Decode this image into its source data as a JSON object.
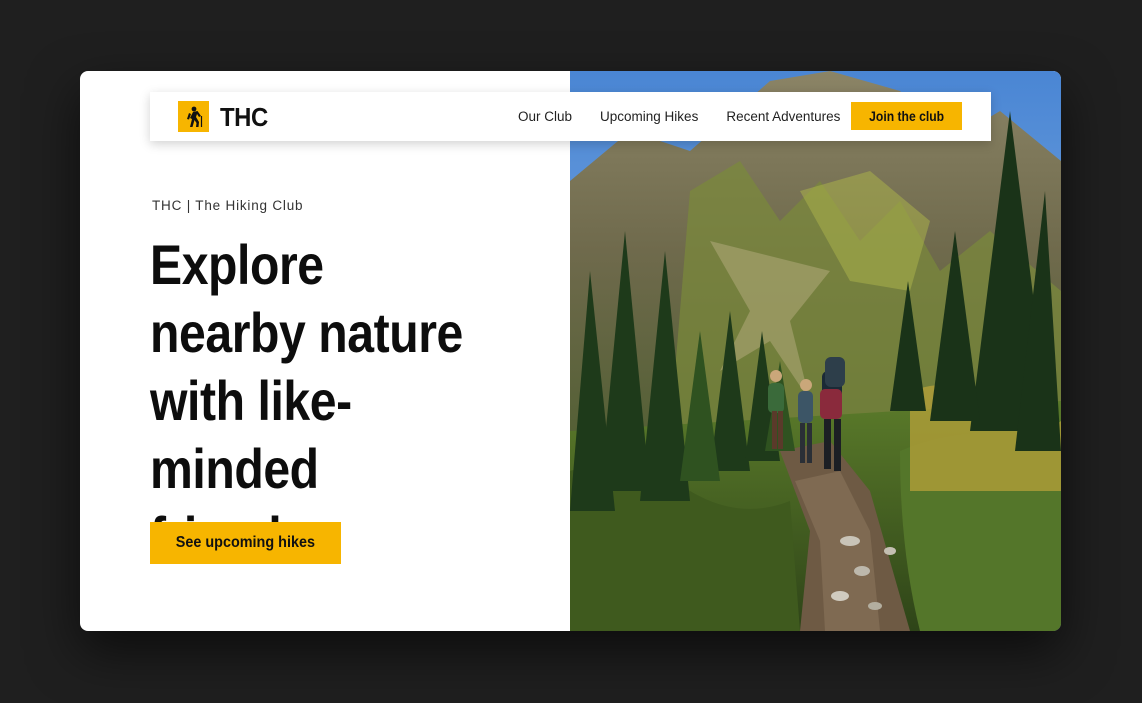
{
  "brand": {
    "name": "THC",
    "icon": "hiker-icon",
    "accent_color": "#f7b500"
  },
  "nav": {
    "links": [
      "Our Club",
      "Upcoming Hikes",
      "Recent Adventures"
    ],
    "cta_label": "Join the club"
  },
  "hero": {
    "eyebrow": "THC | The Hiking Club",
    "headline": "Explore nearby nature with like-minded friends.",
    "cta_label": "See upcoming hikes",
    "image": "hikers-on-forest-trail"
  },
  "colors": {
    "page_background": "#1f1f1f",
    "card_background": "#ffffff",
    "text": "#0d0d0d"
  }
}
